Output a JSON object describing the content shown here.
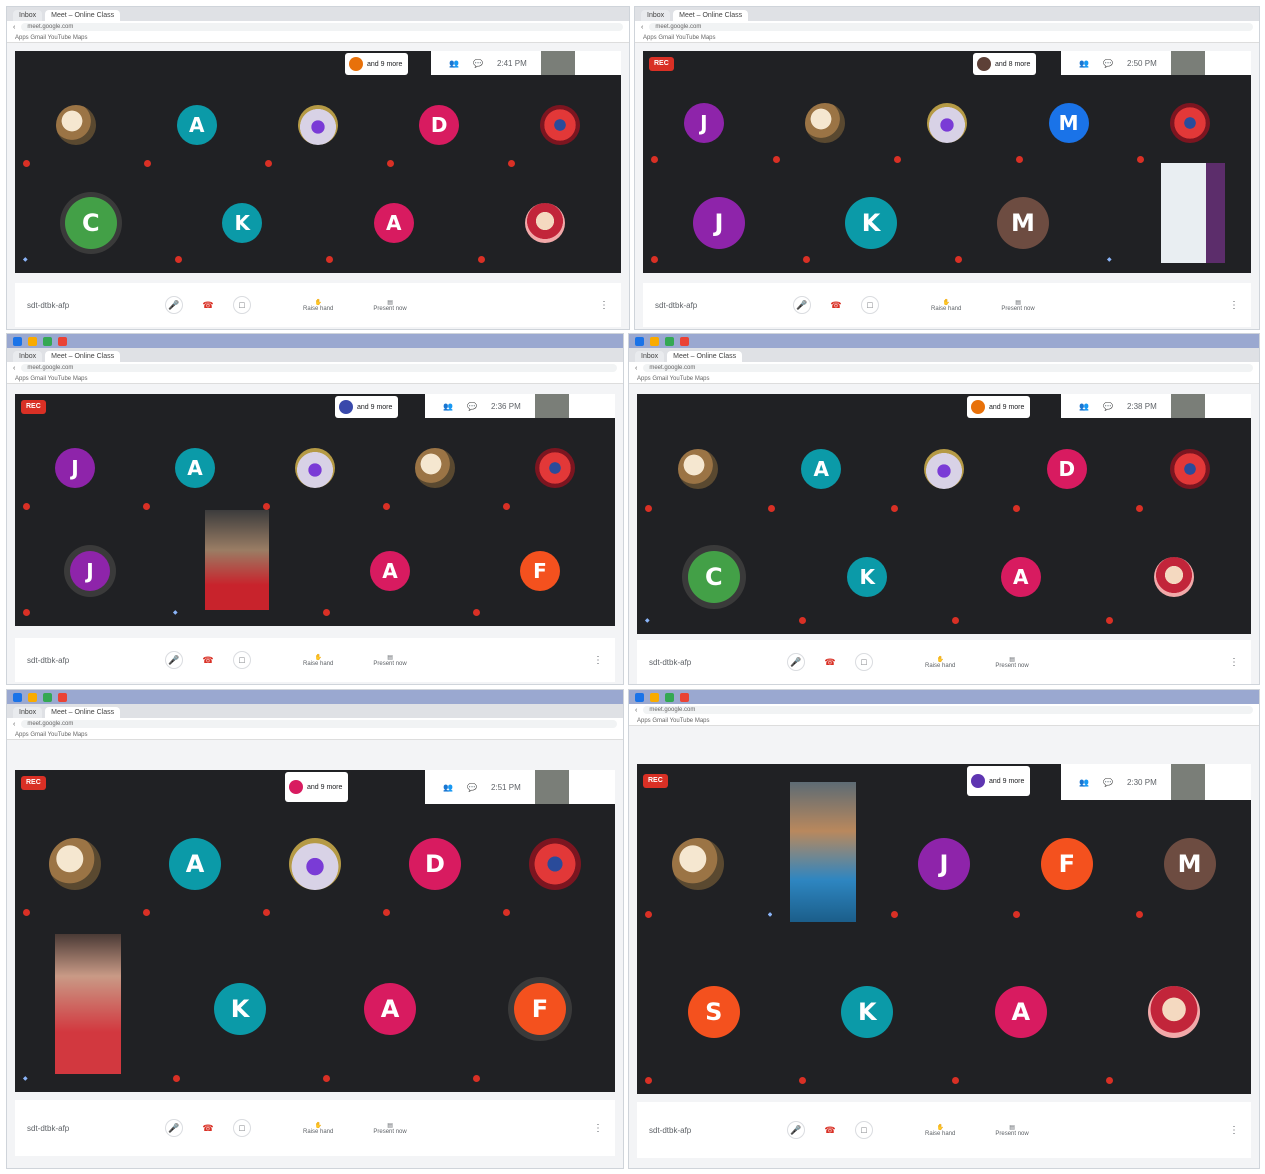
{
  "browser": {
    "tab_active": "Meet – Online Class",
    "tab_other": "Inbox",
    "url": "meet.google.com",
    "bookmarks": "Apps  Gmail  YouTube  Maps"
  },
  "times": [
    "2:41 PM",
    "2:50 PM",
    "2:36 PM",
    "2:38 PM",
    "2:51 PM",
    "2:30 PM"
  ],
  "meeting_code": "sdt-dtbk-afp",
  "rec_label": "REC",
  "controls": {
    "raise": "Raise hand",
    "present": "Present now"
  },
  "presenters": [
    "and 9 more",
    "and 8 more",
    "and 9 more",
    "and 9 more",
    "and 9 more",
    "and 9 more"
  ],
  "icons": {
    "mic": "mic-icon",
    "end": "end-call-icon",
    "cam": "camera-icon",
    "hand": "hand-icon",
    "present": "present-icon",
    "more": "more-vert-icon"
  },
  "colors": {
    "purple": "#8e24aa",
    "teal": "#0b9aa8",
    "pink": "#d81b60",
    "green": "#43a047",
    "orange": "#f4511e",
    "brown": "#6d4c41",
    "blue": "#1a73e8"
  }
}
